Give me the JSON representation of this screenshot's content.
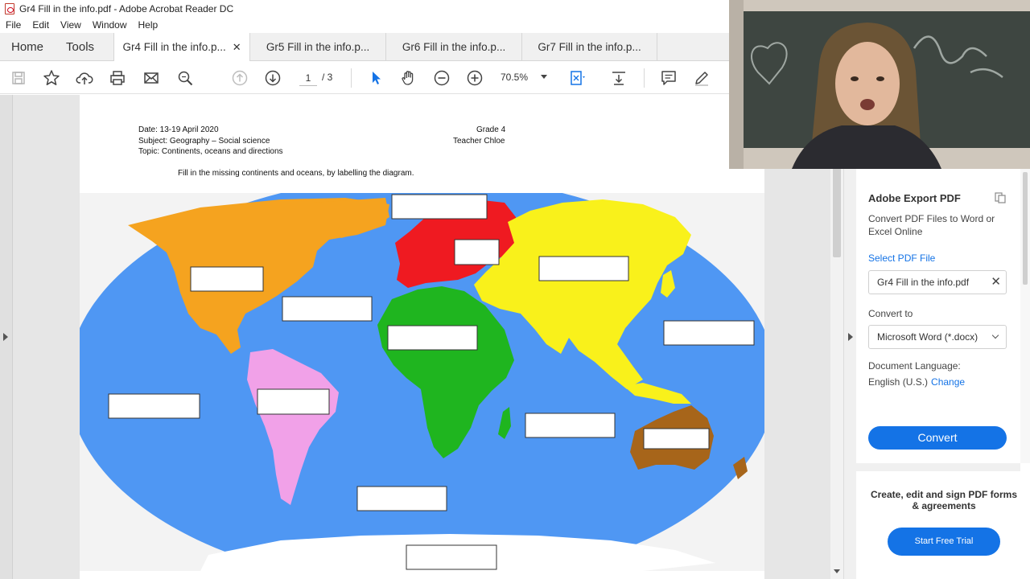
{
  "window": {
    "title": "Gr4 Fill in the info.pdf - Adobe Acrobat Reader DC"
  },
  "menu": [
    "File",
    "Edit",
    "View",
    "Window",
    "Help"
  ],
  "nav_tabs": {
    "home": "Home",
    "tools": "Tools"
  },
  "doc_tabs": [
    {
      "label": "Gr4 Fill in the info.p...",
      "active": true,
      "close": "✕"
    },
    {
      "label": "Gr5 Fill in the info.p...",
      "active": false
    },
    {
      "label": "Gr6 Fill in the info.p...",
      "active": false
    },
    {
      "label": "Gr7 Fill in the info.p...",
      "active": false
    }
  ],
  "toolbar": {
    "current_page": "1",
    "page_total": "/ 3",
    "zoom": "70.5%",
    "icons": [
      "save-icon",
      "star-icon",
      "upload-icon",
      "print-icon",
      "mail-icon",
      "search-icon",
      "page-up-icon",
      "page-down-icon",
      "select-cursor-icon",
      "hand-icon",
      "zoom-out-icon",
      "zoom-in-icon",
      "fit-page-icon",
      "scroll-mode-icon",
      "comment-icon",
      "pen-icon"
    ]
  },
  "document": {
    "date": "Date: 13-19 April 2020",
    "subject": "Subject: Geography – Social science",
    "topic": "Topic: Continents, oceans and directions",
    "grade": "Grade 4",
    "teacher": "Teacher Chloe",
    "instruction": "Fill in the missing continents and oceans, by labelling the diagram.",
    "map": {
      "colors": {
        "ocean": "#4f97f3",
        "north_america": "#f5a31f",
        "south_america": "#f1a1e8",
        "europe": "#ef1a21",
        "africa": "#1fb51f",
        "asia": "#f9f11b",
        "australia": "#a7651a",
        "antarctica": "#ffffff"
      },
      "label_box_count": 13
    }
  },
  "right_pane": {
    "heading": "Adobe Export PDF",
    "description": "Convert PDF Files to Word or Excel Online",
    "select_link": "Select PDF File",
    "file_name": "Gr4 Fill in the info.pdf",
    "file_clear": "✕",
    "convert_to_label": "Convert to",
    "format": "Microsoft Word (*.docx)",
    "doc_language_label": "Document Language:",
    "language": "English (U.S.)",
    "change_link": "Change",
    "convert_button": "Convert",
    "promo": "Create, edit and sign PDF forms & agreements",
    "trial_button": "Start Free Trial"
  },
  "webcam": {
    "description": "presenter"
  }
}
